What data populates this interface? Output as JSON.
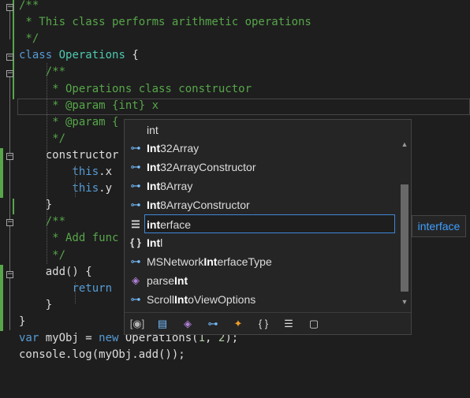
{
  "code_lines": [
    {
      "n": 0,
      "parts": [
        [
          "cm",
          "/**"
        ]
      ]
    },
    {
      "n": 1,
      "parts": [
        [
          "cm",
          " * This class performs arithmetic operations"
        ]
      ]
    },
    {
      "n": 2,
      "parts": [
        [
          "cm",
          " */"
        ]
      ]
    },
    {
      "n": 3,
      "parts": [
        [
          "kw",
          "class"
        ],
        [
          "pl",
          " "
        ],
        [
          "ty",
          "Operations"
        ],
        [
          "pl",
          " {"
        ]
      ]
    },
    {
      "n": 4,
      "parts": [
        [
          "pl",
          "    "
        ],
        [
          "cm",
          "/**"
        ]
      ]
    },
    {
      "n": 5,
      "parts": [
        [
          "pl",
          "    "
        ],
        [
          "cm",
          " * Operations class constructor"
        ]
      ]
    },
    {
      "n": 6,
      "parts": [
        [
          "pl",
          "    "
        ],
        [
          "cm",
          " * @param {int} x"
        ]
      ]
    },
    {
      "n": 7,
      "parts": [
        [
          "pl",
          "    "
        ],
        [
          "cm",
          " * @param {"
        ]
      ]
    },
    {
      "n": 8,
      "parts": [
        [
          "pl",
          "    "
        ],
        [
          "cm",
          " */"
        ]
      ]
    },
    {
      "n": 9,
      "parts": [
        [
          "pl",
          "    "
        ],
        [
          "pl",
          "constructor"
        ]
      ]
    },
    {
      "n": 10,
      "parts": [
        [
          "pl",
          "        "
        ],
        [
          "kw",
          "this"
        ],
        [
          "pl",
          ".x"
        ]
      ]
    },
    {
      "n": 11,
      "parts": [
        [
          "pl",
          "        "
        ],
        [
          "kw",
          "this"
        ],
        [
          "pl",
          ".y"
        ]
      ]
    },
    {
      "n": 12,
      "parts": [
        [
          "pl",
          "    }"
        ]
      ]
    },
    {
      "n": 13,
      "parts": [
        [
          "pl",
          "    "
        ],
        [
          "cm",
          "/**"
        ]
      ]
    },
    {
      "n": 14,
      "parts": [
        [
          "pl",
          "    "
        ],
        [
          "cm",
          " * Add func"
        ]
      ]
    },
    {
      "n": 15,
      "parts": [
        [
          "pl",
          "    "
        ],
        [
          "cm",
          " */"
        ]
      ]
    },
    {
      "n": 16,
      "parts": [
        [
          "pl",
          "    add() {"
        ]
      ]
    },
    {
      "n": 17,
      "parts": [
        [
          "pl",
          "        "
        ],
        [
          "kw",
          "return"
        ]
      ]
    },
    {
      "n": 18,
      "parts": [
        [
          "pl",
          "    }"
        ]
      ]
    },
    {
      "n": 19,
      "parts": [
        [
          "pl",
          "}"
        ]
      ]
    },
    {
      "n": 20,
      "parts": [
        [
          "kw",
          "var"
        ],
        [
          "pl",
          " myObj = "
        ],
        [
          "kw",
          "new"
        ],
        [
          "pl",
          " Operations("
        ],
        [
          "nu",
          "1"
        ],
        [
          "pl",
          ", "
        ],
        [
          "nu",
          "2"
        ],
        [
          "pl",
          ");"
        ]
      ]
    },
    {
      "n": 21,
      "parts": [
        [
          "pl",
          "console.log(myObj.add());"
        ]
      ]
    }
  ],
  "completion": {
    "query": "int",
    "items": [
      {
        "icon": "interface-icon",
        "glyph": "⊶",
        "match": "Int",
        "rest": "32Array",
        "pre": ""
      },
      {
        "icon": "interface-icon",
        "glyph": "⊶",
        "match": "Int",
        "rest": "32ArrayConstructor",
        "pre": ""
      },
      {
        "icon": "interface-icon",
        "glyph": "⊶",
        "match": "Int",
        "rest": "8Array",
        "pre": ""
      },
      {
        "icon": "interface-icon",
        "glyph": "⊶",
        "match": "Int",
        "rest": "8ArrayConstructor",
        "pre": ""
      },
      {
        "icon": "keyword-icon",
        "glyph": "☰",
        "match": "int",
        "rest": "erface",
        "pre": "",
        "selected": true
      },
      {
        "icon": "namespace-icon",
        "glyph": "{ }",
        "match": "Int",
        "rest": "l",
        "pre": ""
      },
      {
        "icon": "interface-icon",
        "glyph": "⊶",
        "match": "Int",
        "rest": "erfaceType",
        "pre": "MSNetwork"
      },
      {
        "icon": "method-icon",
        "glyph": "◈",
        "match": "Int",
        "rest": "",
        "pre": "parse"
      },
      {
        "icon": "interface-icon",
        "glyph": "⊶",
        "match": "Int",
        "rest": "oViewOptions",
        "pre": "Scroll"
      }
    ],
    "filters": [
      {
        "icon": "variable-filter-icon",
        "glyph": "[◉]",
        "color": "#b4b4b4"
      },
      {
        "icon": "constant-filter-icon",
        "glyph": "▤",
        "color": "#75beff"
      },
      {
        "icon": "method-filter-icon",
        "glyph": "◈",
        "color": "#b180d7"
      },
      {
        "icon": "interface-filter-icon",
        "glyph": "⊶",
        "color": "#75beff"
      },
      {
        "icon": "class-filter-icon",
        "glyph": "✦",
        "color": "#ee9d28"
      },
      {
        "icon": "namespace-filter-icon",
        "glyph": "{ }",
        "color": "#dcdcdc"
      },
      {
        "icon": "keyword-filter-icon",
        "glyph": "☰",
        "color": "#dcdcdc"
      },
      {
        "icon": "snippet-filter-icon",
        "glyph": "▢",
        "color": "#dcdcdc"
      }
    ]
  },
  "tooltip": {
    "text": "interface"
  }
}
